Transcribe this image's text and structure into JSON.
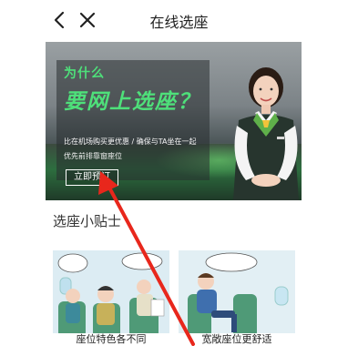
{
  "header": {
    "title": "在线选座"
  },
  "banner": {
    "question": "为什么",
    "headline": "要网上选座？",
    "line1": "比在机场购买更优惠 / 确保与TA坐在一起",
    "line2": "优先前排靠窗座位",
    "book_label": "立即预订"
  },
  "tips": {
    "title": "选座小贴士",
    "cards": [
      {
        "caption": "座位特色各不同"
      },
      {
        "caption": "宽敞座位更舒适"
      }
    ]
  },
  "colors": {
    "accent_green": "#4ee07a",
    "annotation_red": "#e8271c"
  }
}
